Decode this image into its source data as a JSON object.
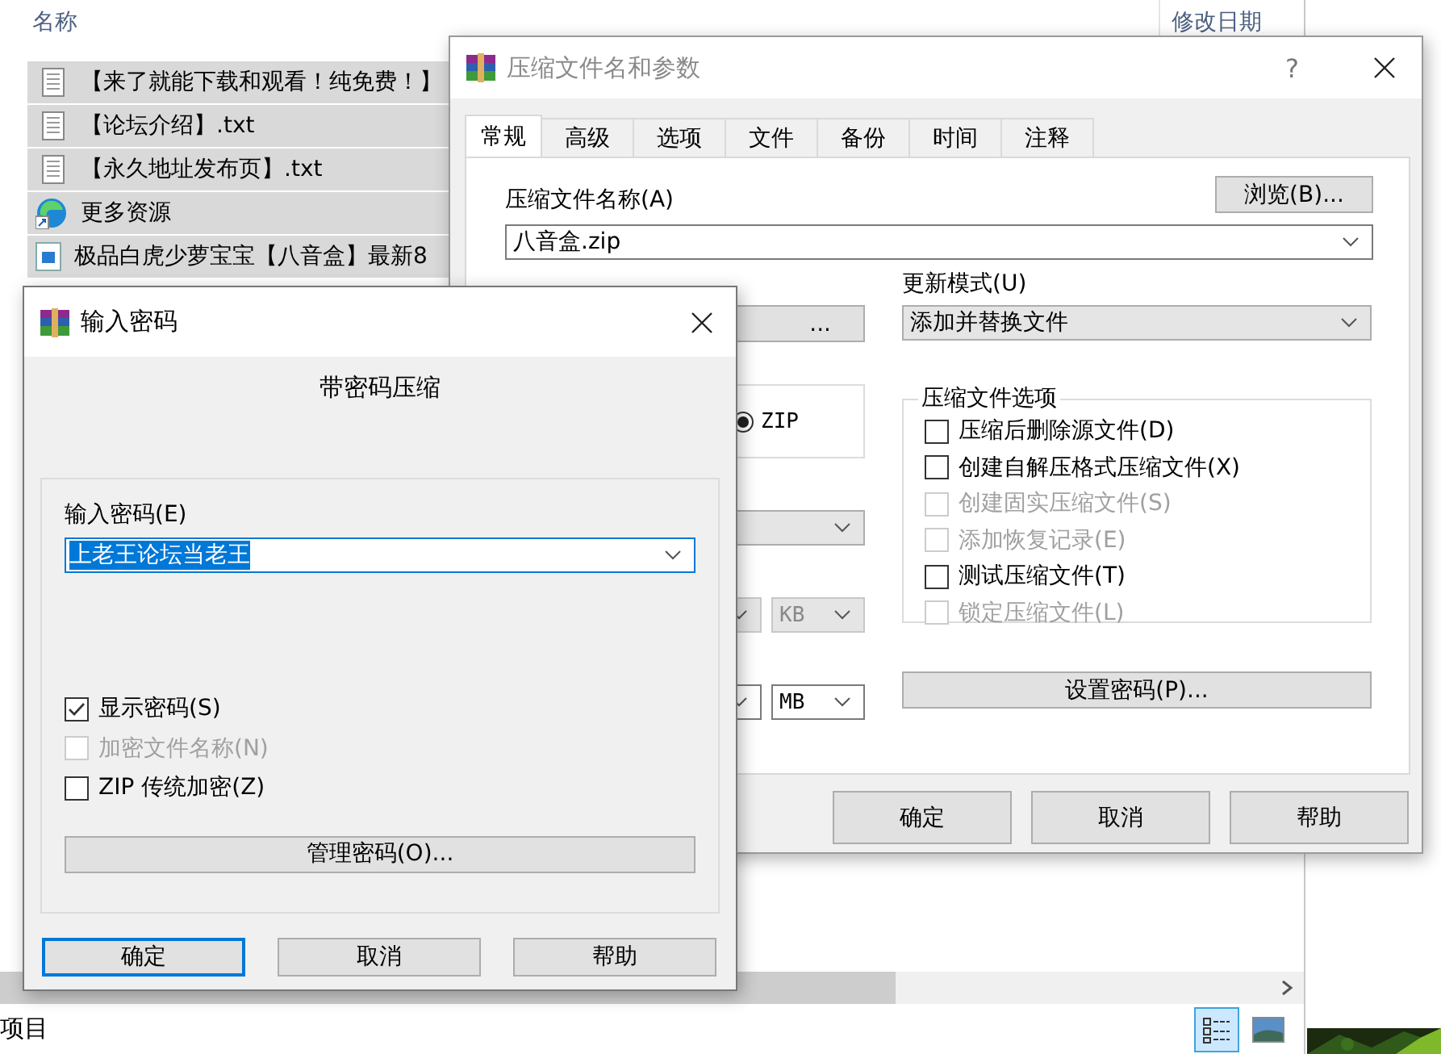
{
  "explorer": {
    "columns": [
      "名称",
      "修改日期"
    ],
    "files": [
      {
        "name": "【来了就能下载和观看！纯免费！】",
        "kind": "text",
        "selected": true
      },
      {
        "name": "【论坛介绍】.txt",
        "kind": "text",
        "selected": true
      },
      {
        "name": "【永久地址发布页】.txt",
        "kind": "text",
        "selected": true
      },
      {
        "name": "更多资源",
        "kind": "shortcut",
        "selected": true
      },
      {
        "name": "极品白虎少萝宝宝【八音盒】最新8",
        "kind": "document",
        "selected": true
      }
    ],
    "status": "项目",
    "view_buttons": [
      {
        "kind": "details",
        "selected": true
      },
      {
        "kind": "preview",
        "selected": false
      }
    ]
  },
  "archive_dialog": {
    "title": "压缩文件名和参数",
    "help_button": "?",
    "tabs": [
      {
        "label": "常规",
        "selected": true
      },
      {
        "label": "高级",
        "selected": false
      },
      {
        "label": "选项",
        "selected": false
      },
      {
        "label": "文件",
        "selected": false
      },
      {
        "label": "备份",
        "selected": false
      },
      {
        "label": "时间",
        "selected": false
      },
      {
        "label": "注释",
        "selected": false
      }
    ],
    "archive_name_label": "压缩文件名称(A)",
    "browse_button": "浏览(B)...",
    "archive_name": "八音盒.zip",
    "profile_button": "...",
    "format_option": {
      "label": "ZIP",
      "selected": true
    },
    "update_mode_label": "更新模式(U)",
    "update_mode": "添加并替换文件",
    "options_title": "压缩文件选项",
    "options": [
      {
        "label": "压缩后删除源文件(D)",
        "checked": false,
        "disabled": false
      },
      {
        "label": "创建自解压格式压缩文件(X)",
        "checked": false,
        "disabled": false
      },
      {
        "label": "创建固实压缩文件(S)",
        "checked": false,
        "disabled": true
      },
      {
        "label": "添加恢复记录(E)",
        "checked": false,
        "disabled": true
      },
      {
        "label": "测试压缩文件(T)",
        "checked": false,
        "disabled": false
      },
      {
        "label": "锁定压缩文件(L)",
        "checked": false,
        "disabled": true
      }
    ],
    "units": [
      {
        "value": "KB",
        "disabled": true
      },
      {
        "value": "MB",
        "disabled": false
      }
    ],
    "set_password_button": "设置密码(P)...",
    "buttons": [
      "确定",
      "取消",
      "帮助"
    ]
  },
  "password_dialog": {
    "title": "输入密码",
    "heading": "带密码压缩",
    "password_label": "输入密码(E)",
    "password": "上老王论坛当老王",
    "options": [
      {
        "label": "显示密码(S)",
        "checked": true,
        "disabled": false
      },
      {
        "label": "加密文件名称(N)",
        "checked": false,
        "disabled": true
      },
      {
        "label": "ZIP 传统加密(Z)",
        "checked": false,
        "disabled": false
      }
    ],
    "manage_button": "管理密码(O)...",
    "buttons": [
      {
        "label": "确定",
        "focused": true
      },
      {
        "label": "取消",
        "focused": false
      },
      {
        "label": "帮助",
        "focused": false
      }
    ]
  }
}
